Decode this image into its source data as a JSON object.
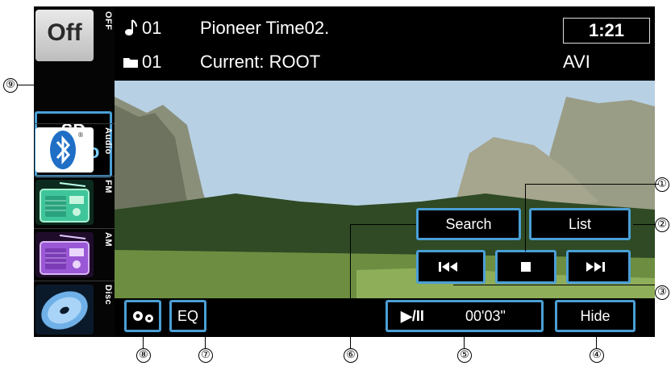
{
  "status": {
    "track_icon": "music-note-icon",
    "track_number": "01",
    "track_title": "Pioneer Time02.",
    "folder_icon": "folder-icon",
    "folder_number": "01",
    "current_folder": "Current: ROOT",
    "elapsed_clock": "1:21",
    "format": "AVI"
  },
  "source_rail": {
    "off_label": "Off",
    "off_side": "OFF",
    "sd_label_line1": "SD",
    "sd_label_line2": "Video",
    "bt_side": "Audio",
    "fm_side": "FM",
    "am_side": "AM",
    "disc_side": "Disc"
  },
  "controls": {
    "search": "Search",
    "list": "List",
    "prev_icon": "skip-previous-icon",
    "stop_icon": "stop-icon",
    "next_icon": "skip-next-icon",
    "play_pause": "▶/II",
    "playback_time": "00'03\"",
    "hide": "Hide",
    "settings_icon": "settings-gears-icon",
    "eq": "EQ"
  },
  "callouts": {
    "c1": "①",
    "c2": "②",
    "c3": "③",
    "c4": "④",
    "c5": "⑤",
    "c6": "⑥",
    "c7": "⑦",
    "c8": "⑧",
    "c9": "⑨"
  },
  "colors": {
    "accent_border": "#4a9fd6",
    "background": "#000000",
    "text": "#ffffff"
  }
}
